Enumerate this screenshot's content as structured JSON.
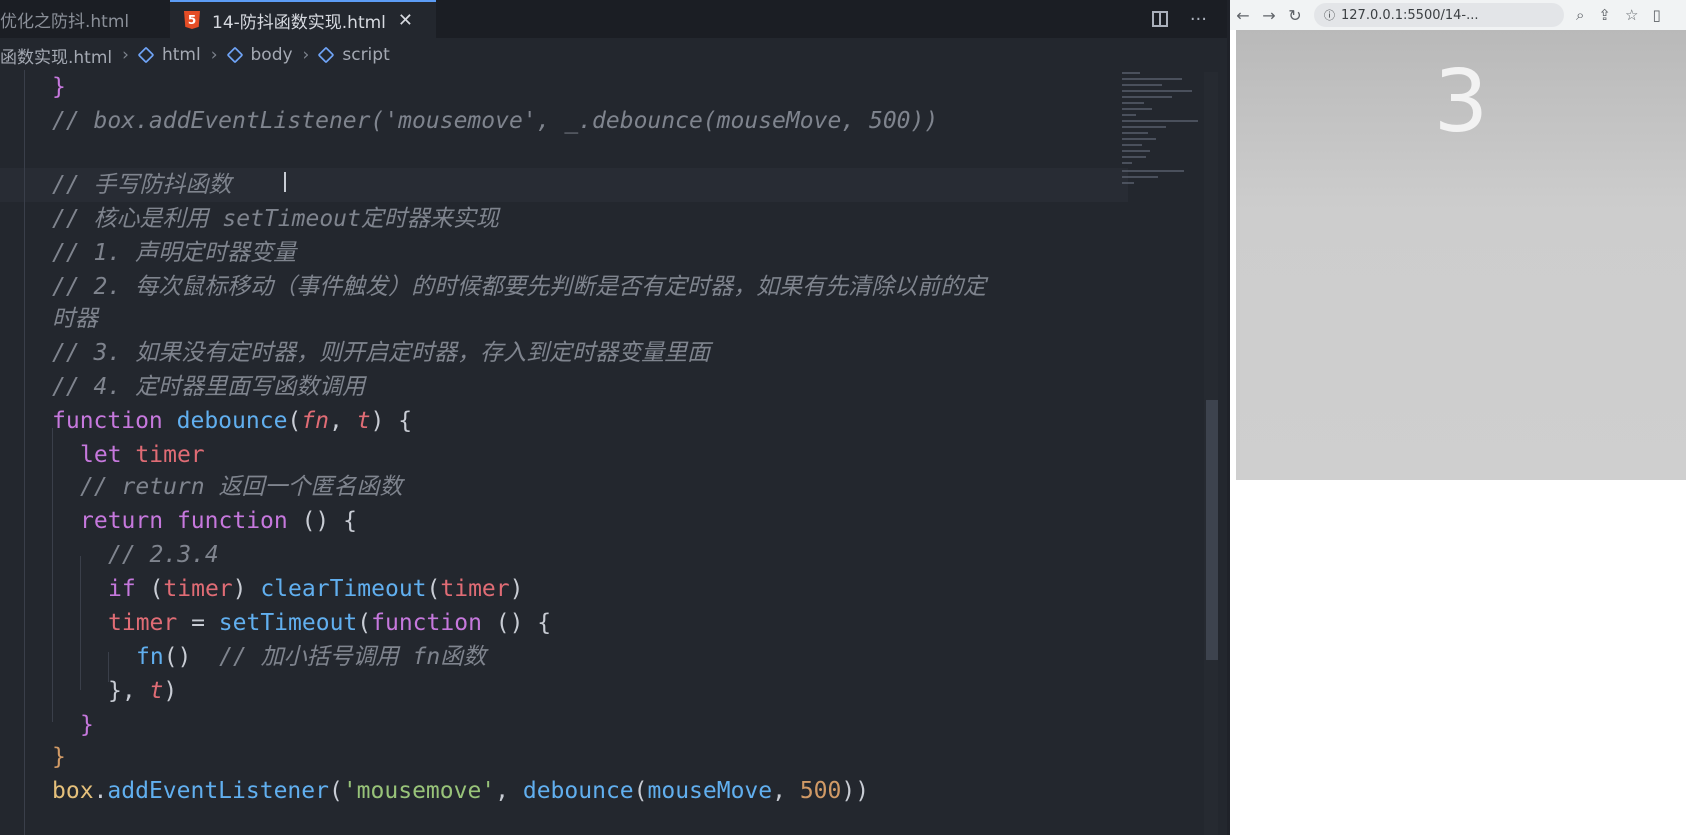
{
  "tabs": {
    "inactive_label": "优化之防抖.html",
    "active_label": "14-防抖函数实现.html",
    "close_glyph": "✕",
    "more_glyph": "···"
  },
  "breadcrumb": {
    "file": "函数实现.html",
    "items": [
      "html",
      "body",
      "script"
    ]
  },
  "code": {
    "lines": [
      "}",
      "// box.addEventListener('mousemove', _.debounce(mouseMove, 500))",
      "",
      "// 手写防抖函数",
      "// 核心是利用 setTimeout定时器来实现",
      "// 1. 声明定时器变量",
      "// 2. 每次鼠标移动（事件触发）的时候都要先判断是否有定时器，如果有先清除以前的定",
      "时器",
      "// 3. 如果没有定时器，则开启定时器，存入到定时器变量里面",
      "// 4. 定时器里面写函数调用",
      "function debounce(fn, t) {",
      "let timer",
      "// return 返回一个匿名函数",
      "return function () {",
      "// 2.3.4",
      "if (timer) clearTimeout(timer)",
      "timer = setTimeout(function () {",
      "fn()  // 加小括号调用 fn函数",
      "}, t)",
      "}",
      "}",
      "box.addEventListener('mousemove', debounce(mouseMove, 500))"
    ]
  },
  "browser": {
    "url": "127.0.0.1:5500/14-...",
    "back_glyph": "←",
    "forward_glyph": "→",
    "reload_glyph": "↻",
    "counter_value": "3"
  }
}
